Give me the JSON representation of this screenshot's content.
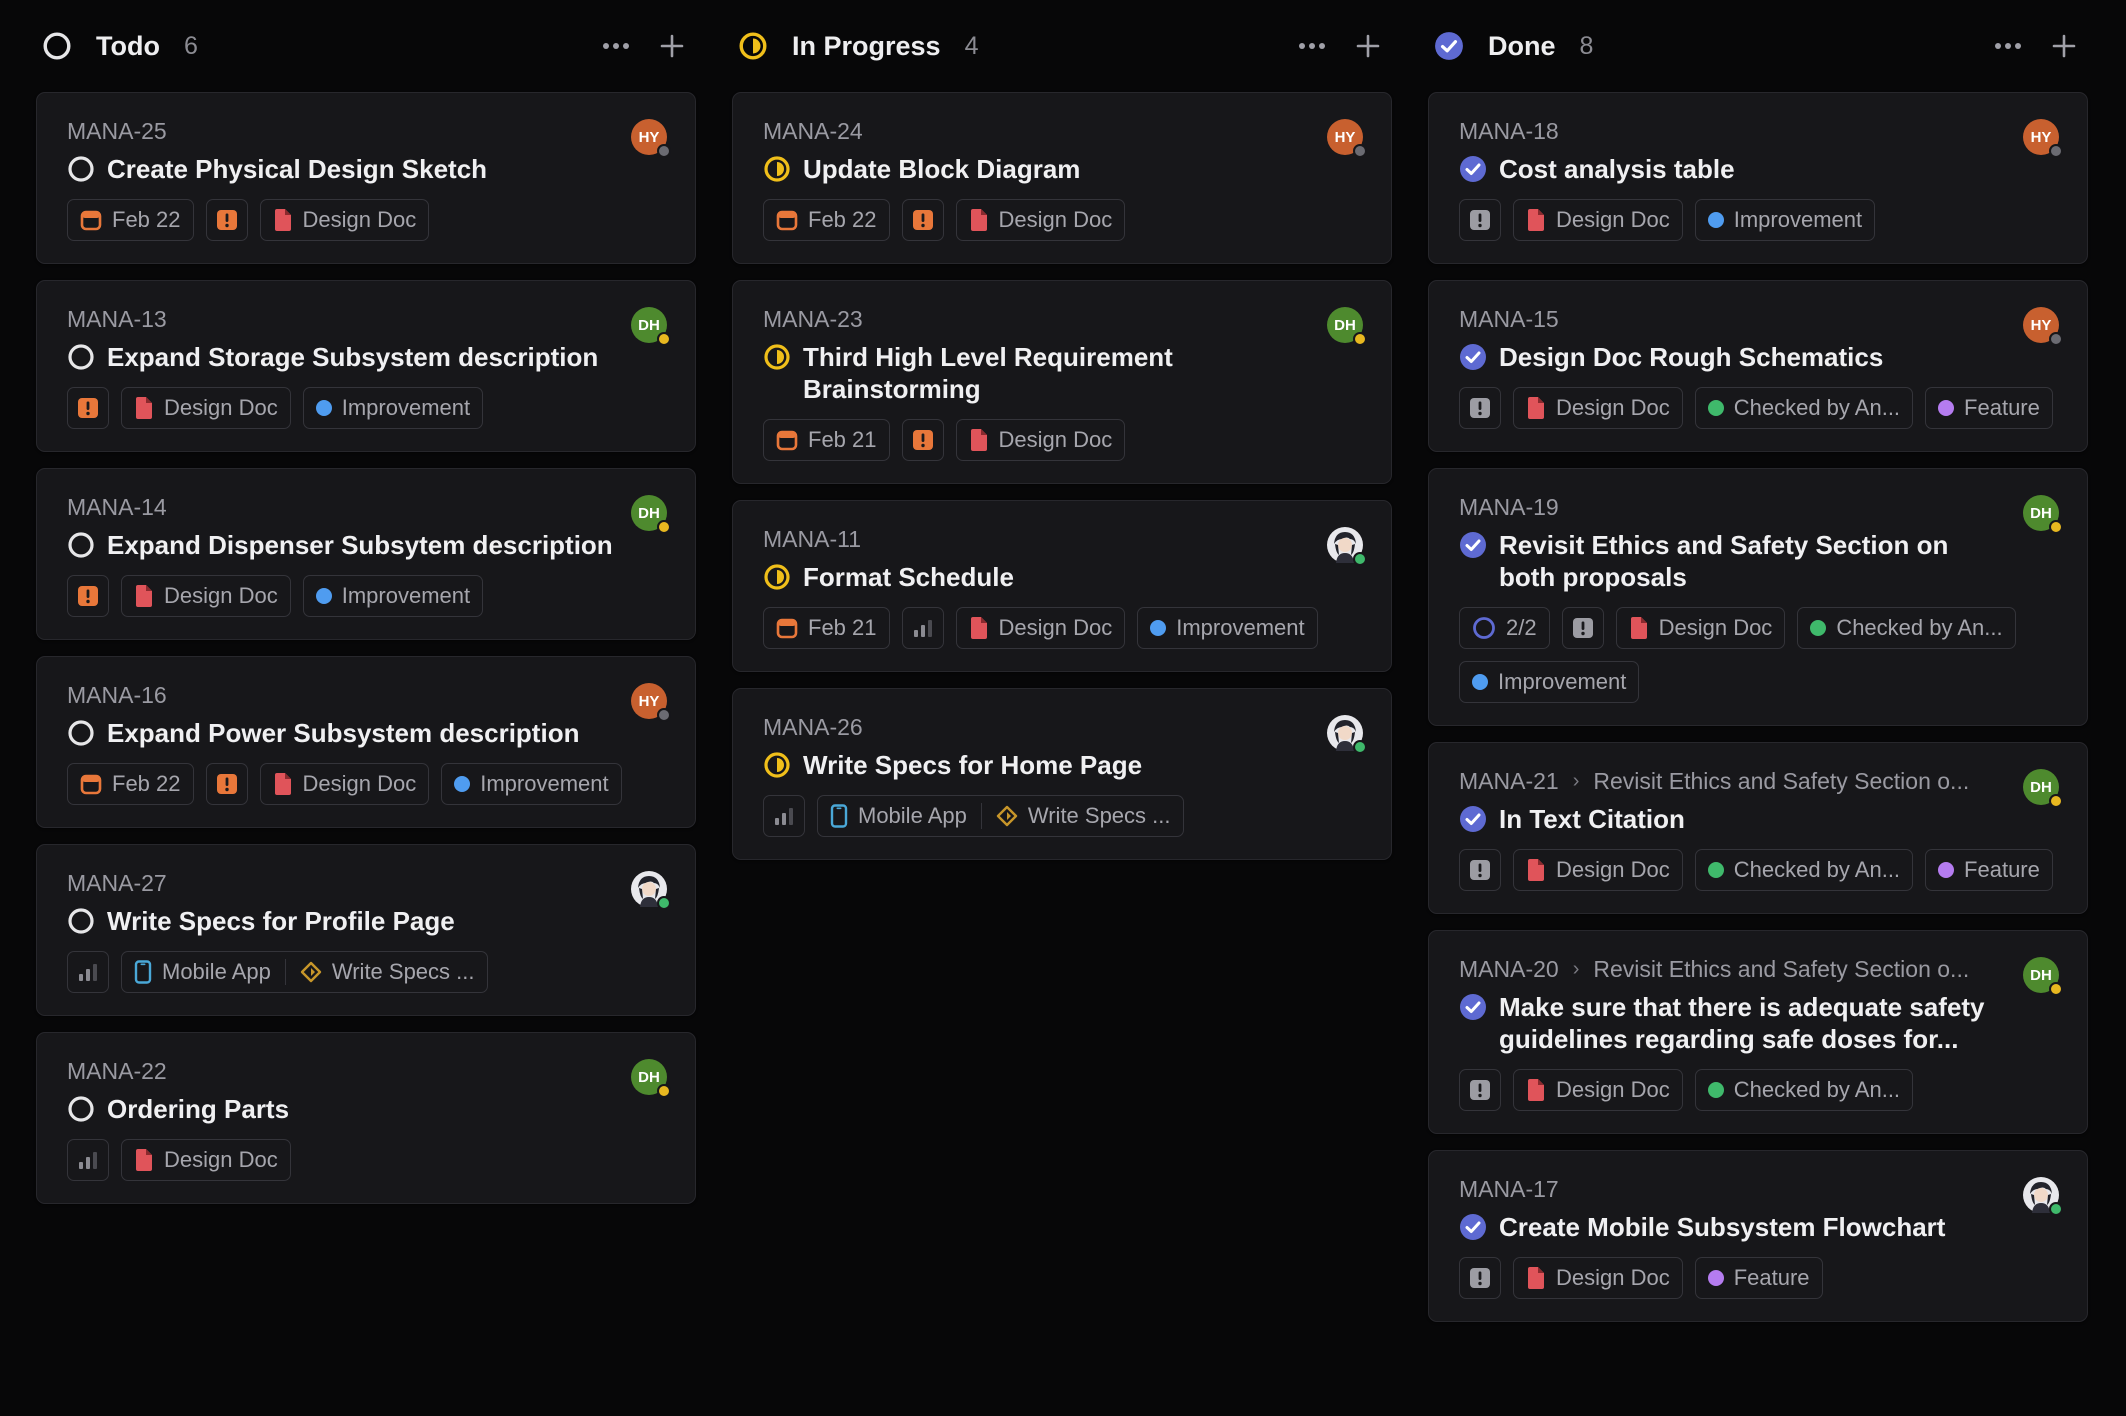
{
  "columns": [
    {
      "key": "todo",
      "title": "Todo",
      "count": "6",
      "cards": [
        {
          "id": "MANA-25",
          "title": "Create Physical Design Sketch",
          "avatar": {
            "initials": "HY",
            "color": "#c8602f",
            "status_color": "#6b6b72"
          },
          "chips": [
            {
              "type": "date",
              "text": "Feb 22"
            },
            {
              "type": "urgent"
            },
            {
              "type": "doc",
              "text": "Design Doc"
            }
          ]
        },
        {
          "id": "MANA-13",
          "title": "Expand Storage Subsystem description",
          "avatar": {
            "initials": "DH",
            "color": "#4e8a2e",
            "status_color": "#e8b820"
          },
          "chips": [
            {
              "type": "urgent"
            },
            {
              "type": "doc",
              "text": "Design Doc"
            },
            {
              "type": "label",
              "text": "Improvement",
              "color": "#4f9cf0"
            }
          ]
        },
        {
          "id": "MANA-14",
          "title": "Expand Dispenser Subsytem description",
          "avatar": {
            "initials": "DH",
            "color": "#4e8a2e",
            "status_color": "#e8b820"
          },
          "chips": [
            {
              "type": "urgent"
            },
            {
              "type": "doc",
              "text": "Design Doc"
            },
            {
              "type": "label",
              "text": "Improvement",
              "color": "#4f9cf0"
            }
          ]
        },
        {
          "id": "MANA-16",
          "title": "Expand Power Subsystem description",
          "avatar": {
            "initials": "HY",
            "color": "#c8602f",
            "status_color": "#6b6b72"
          },
          "chips": [
            {
              "type": "date",
              "text": "Feb 22"
            },
            {
              "type": "urgent"
            },
            {
              "type": "doc",
              "text": "Design Doc"
            },
            {
              "type": "label",
              "text": "Improvement",
              "color": "#4f9cf0"
            }
          ]
        },
        {
          "id": "MANA-27",
          "title": "Write Specs for Profile Page",
          "avatar": {
            "photo": true,
            "status_color": "#3fb96b"
          },
          "chips": [
            {
              "type": "priority"
            },
            {
              "type": "project",
              "text": "Mobile App",
              "milestone": "Write Specs ..."
            }
          ]
        },
        {
          "id": "MANA-22",
          "title": "Ordering Parts",
          "avatar": {
            "initials": "DH",
            "color": "#4e8a2e",
            "status_color": "#e8b820"
          },
          "chips": [
            {
              "type": "priority"
            },
            {
              "type": "doc",
              "text": "Design Doc"
            }
          ]
        }
      ]
    },
    {
      "key": "inprogress",
      "title": "In Progress",
      "count": "4",
      "cards": [
        {
          "id": "MANA-24",
          "title": "Update Block Diagram",
          "avatar": {
            "initials": "HY",
            "color": "#c8602f",
            "status_color": "#6b6b72"
          },
          "chips": [
            {
              "type": "date",
              "text": "Feb 22"
            },
            {
              "type": "urgent"
            },
            {
              "type": "doc",
              "text": "Design Doc"
            }
          ]
        },
        {
          "id": "MANA-23",
          "title": "Third High Level Requirement Brainstorming",
          "avatar": {
            "initials": "DH",
            "color": "#4e8a2e",
            "status_color": "#e8b820"
          },
          "chips": [
            {
              "type": "date",
              "text": "Feb 21"
            },
            {
              "type": "urgent"
            },
            {
              "type": "doc",
              "text": "Design Doc"
            }
          ]
        },
        {
          "id": "MANA-11",
          "title": "Format Schedule",
          "avatar": {
            "photo": true,
            "status_color": "#3fb96b"
          },
          "chips": [
            {
              "type": "date",
              "text": "Feb 21"
            },
            {
              "type": "priority"
            },
            {
              "type": "doc",
              "text": "Design Doc"
            },
            {
              "type": "label",
              "text": "Improvement",
              "color": "#4f9cf0"
            }
          ]
        },
        {
          "id": "MANA-26",
          "title": "Write Specs for Home Page",
          "avatar": {
            "photo": true,
            "status_color": "#3fb96b"
          },
          "chips": [
            {
              "type": "priority"
            },
            {
              "type": "project",
              "text": "Mobile App",
              "milestone": "Write Specs ..."
            }
          ]
        }
      ]
    },
    {
      "key": "done",
      "title": "Done",
      "count": "8",
      "cards": [
        {
          "id": "MANA-18",
          "title": "Cost analysis table",
          "avatar": {
            "initials": "HY",
            "color": "#c8602f",
            "status_color": "#6b6b72"
          },
          "chips": [
            {
              "type": "urgent_grey"
            },
            {
              "type": "doc",
              "text": "Design Doc"
            },
            {
              "type": "label",
              "text": "Improvement",
              "color": "#4f9cf0"
            }
          ]
        },
        {
          "id": "MANA-15",
          "title": "Design Doc Rough Schematics",
          "avatar": {
            "initials": "HY",
            "color": "#c8602f",
            "status_color": "#6b6b72"
          },
          "chips": [
            {
              "type": "urgent_grey"
            },
            {
              "type": "doc",
              "text": "Design Doc"
            },
            {
              "type": "label",
              "text": "Checked by An...",
              "color": "#3fb96b"
            },
            {
              "type": "label",
              "text": "Feature",
              "color": "#b57cf0"
            }
          ]
        },
        {
          "id": "MANA-19",
          "title": "Revisit Ethics and Safety Section on both proposals",
          "avatar": {
            "initials": "DH",
            "color": "#4e8a2e",
            "status_color": "#e8b820"
          },
          "chips": [
            {
              "type": "subissues",
              "text": "2/2"
            },
            {
              "type": "urgent_grey"
            },
            {
              "type": "doc",
              "text": "Design Doc"
            },
            {
              "type": "label",
              "text": "Checked by An...",
              "color": "#3fb96b"
            },
            {
              "type": "label",
              "text": "Improvement",
              "color": "#4f9cf0"
            }
          ]
        },
        {
          "id": "MANA-21",
          "parent": "Revisit Ethics and Safety Section o...",
          "title": "In Text Citation",
          "avatar": {
            "initials": "DH",
            "color": "#4e8a2e",
            "status_color": "#e8b820"
          },
          "chips": [
            {
              "type": "urgent_grey"
            },
            {
              "type": "doc",
              "text": "Design Doc"
            },
            {
              "type": "label",
              "text": "Checked by An...",
              "color": "#3fb96b"
            },
            {
              "type": "label",
              "text": "Feature",
              "color": "#b57cf0"
            }
          ]
        },
        {
          "id": "MANA-20",
          "parent": "Revisit Ethics and Safety Section o...",
          "title": "Make sure that there is adequate safety guidelines regarding safe doses for...",
          "avatar": {
            "initials": "DH",
            "color": "#4e8a2e",
            "status_color": "#e8b820"
          },
          "chips": [
            {
              "type": "urgent_grey"
            },
            {
              "type": "doc",
              "text": "Design Doc"
            },
            {
              "type": "label",
              "text": "Checked by An...",
              "color": "#3fb96b"
            }
          ]
        },
        {
          "id": "MANA-17",
          "title": "Create Mobile Subsystem Flowchart",
          "avatar": {
            "photo": true,
            "status_color": "#3fb96b"
          },
          "chips": [
            {
              "type": "urgent_grey"
            },
            {
              "type": "doc",
              "text": "Design Doc"
            },
            {
              "type": "label",
              "text": "Feature",
              "color": "#b57cf0"
            }
          ]
        }
      ]
    }
  ],
  "colors": {
    "todo_status": "#e6e6e8",
    "inprogress_status": "#f0bf1a",
    "done_status": "#5e6ad2",
    "urgent": "#e8773a",
    "doc": "#e0545a",
    "date": "#e8773a",
    "mobile": "#4aa8d8",
    "milestone": "#c7962a"
  }
}
